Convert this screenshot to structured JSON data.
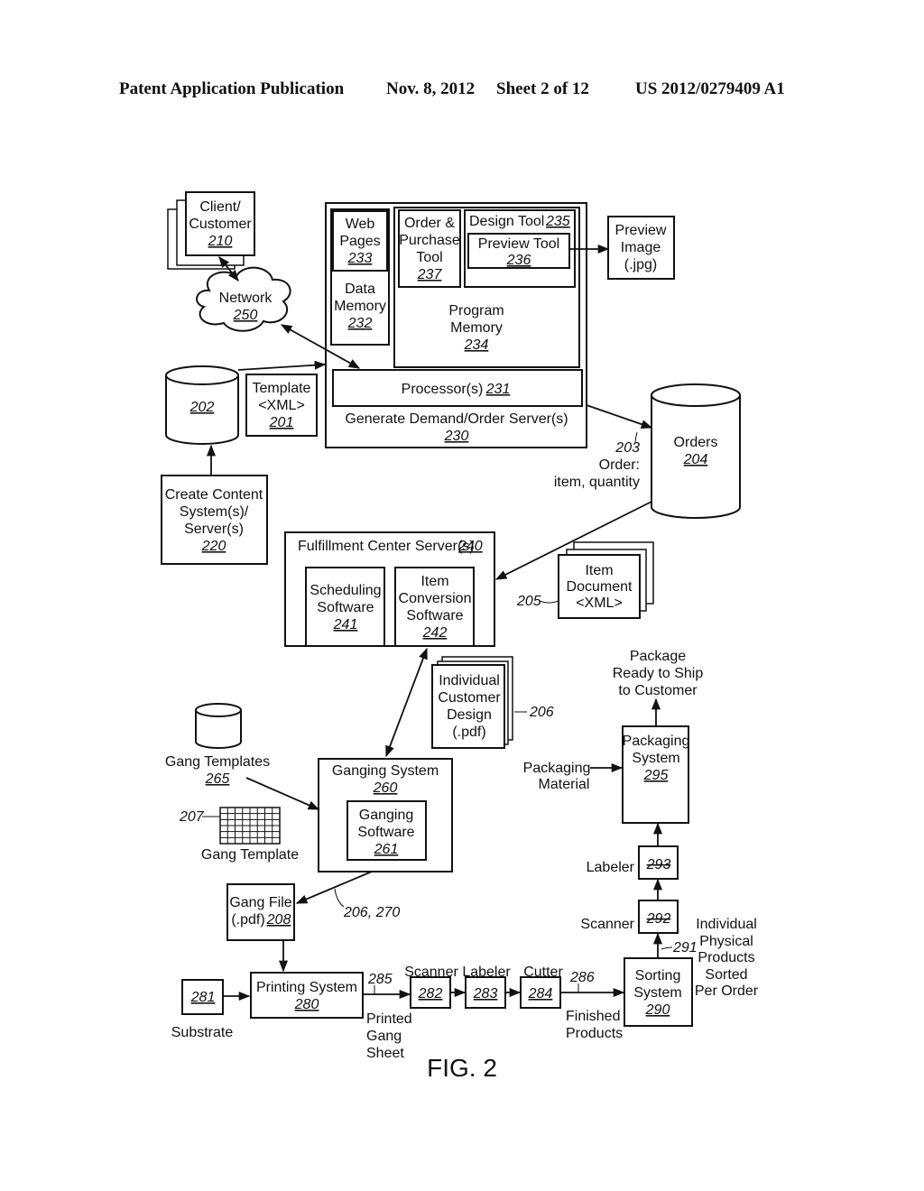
{
  "header": {
    "publication": "Patent Application Publication",
    "date": "Nov. 8, 2012",
    "sheet": "Sheet 2 of 12",
    "number": "US 2012/0279409 A1"
  },
  "figure_label": "FIG. 2",
  "nodes": {
    "client": {
      "lines": [
        "Client/",
        "Customer"
      ],
      "ref": "210"
    },
    "network": {
      "lines": [
        "Network"
      ],
      "ref": "250"
    },
    "db202": {
      "lines": [],
      "ref": "202"
    },
    "template": {
      "lines": [
        "Template",
        "<XML>"
      ],
      "ref": "201"
    },
    "create_content": {
      "lines": [
        "Create Content",
        "System(s)/",
        "Server(s)"
      ],
      "ref": "220"
    },
    "server230": {
      "lines": [
        "Generate Demand/Order Server(s)"
      ],
      "ref": "230"
    },
    "web_pages": {
      "lines": [
        "Web",
        "Pages"
      ],
      "ref": "233"
    },
    "data_memory": {
      "lines": [
        "Data",
        "Memory"
      ],
      "ref": "232"
    },
    "order_tool": {
      "lines": [
        "Order &",
        "Purchase",
        "Tool"
      ],
      "ref": "237"
    },
    "design_tool": {
      "lines": [
        "Design Tool"
      ],
      "ref": "235"
    },
    "preview_tool": {
      "lines": [
        "Preview Tool"
      ],
      "ref": "236"
    },
    "program_memory": {
      "lines": [
        "Program",
        "Memory"
      ],
      "ref": "234"
    },
    "processor": {
      "lines": [
        "Processor(s)"
      ],
      "ref": "231"
    },
    "preview_image": {
      "lines": [
        "Preview",
        "Image",
        "(.jpg)"
      ]
    },
    "orders": {
      "lines": [
        "Orders"
      ],
      "ref": "204"
    },
    "order_label": {
      "ref": "203",
      "lines": [
        "Order:",
        "item, quantity"
      ]
    },
    "fulfillment": {
      "lines": [
        "Fulfillment Center Server(s)"
      ],
      "ref": "240"
    },
    "scheduling": {
      "lines": [
        "Scheduling",
        "Software"
      ],
      "ref": "241"
    },
    "item_conversion": {
      "lines": [
        "Item",
        "Conversion",
        "Software"
      ],
      "ref": "242"
    },
    "item_document": {
      "lines": [
        "Item",
        "Document",
        "<XML>"
      ],
      "ref": "205"
    },
    "customer_design": {
      "lines": [
        "Individual",
        "Customer",
        "Design",
        "(.pdf)"
      ],
      "ref": "206"
    },
    "gang_templates": {
      "lines": [
        "Gang Templates"
      ],
      "ref": "265"
    },
    "gang_template": {
      "lines": [
        "Gang Template"
      ],
      "ref": "207"
    },
    "ganging_system": {
      "lines": [
        "Ganging System"
      ],
      "ref": "260"
    },
    "ganging_software": {
      "lines": [
        "Ganging",
        "Software"
      ],
      "ref": "261"
    },
    "gang_file": {
      "lines": [
        "Gang File",
        "(.pdf)"
      ],
      "ref": "208"
    },
    "arrow_206_270": {
      "ref": "206, 270"
    },
    "substrate": {
      "lines": [
        "Substrate"
      ],
      "ref": "281"
    },
    "printing": {
      "lines": [
        "Printing System"
      ],
      "ref": "280"
    },
    "printed_sheet": {
      "ref": "285",
      "lines": [
        "Printed",
        "Gang",
        "Sheet"
      ]
    },
    "scanner282": {
      "lines": [
        "Scanner"
      ],
      "ref": "282"
    },
    "labeler283": {
      "lines": [
        "Labeler"
      ],
      "ref": "283"
    },
    "cutter284": {
      "lines": [
        "Cutter"
      ],
      "ref": "284"
    },
    "finished": {
      "ref": "286",
      "lines": [
        "Finished",
        "Products"
      ]
    },
    "sorting": {
      "lines": [
        "Sorting",
        "System"
      ],
      "ref": "290"
    },
    "sorted_label": {
      "ref": "291",
      "lines": [
        "Individual",
        "Physical",
        "Products",
        "Sorted",
        "Per Order"
      ]
    },
    "scanner292": {
      "lines": [
        "Scanner"
      ],
      "ref": "292"
    },
    "labeler293": {
      "lines": [
        "Labeler"
      ],
      "ref": "293"
    },
    "packaging": {
      "lines": [
        "Packaging",
        "System"
      ],
      "ref": "295"
    },
    "packaging_material": {
      "lines": [
        "Packaging",
        "Material"
      ]
    },
    "ship": {
      "lines": [
        "Package",
        "Ready to Ship",
        "to Customer"
      ]
    }
  }
}
